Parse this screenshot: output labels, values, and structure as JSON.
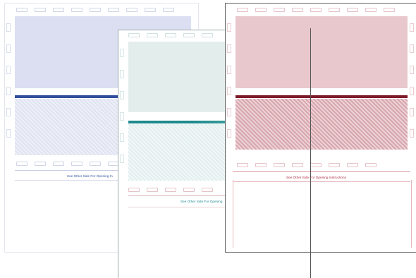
{
  "colors": {
    "blue": {
      "panel": "#dcdff2",
      "band": "#2f4f9c",
      "pattern": "#cfd6ea",
      "ink": "#2f4f9c",
      "holes": "#aab3d6"
    },
    "green": {
      "panel": "#e3eeec",
      "band": "#1d8a8c",
      "pattern": "#dde9ea",
      "ink": "#1d8a8c",
      "holes": "#a7c9c8"
    },
    "red": {
      "panel": "#e8c8cc",
      "band": "#7e1a2a",
      "pattern": "#cf98a2",
      "ink": "#b0283c",
      "holes": "#d0909a"
    }
  },
  "forms": [
    {
      "id": "blue",
      "caption": "See Other Side For Opening In"
    },
    {
      "id": "green",
      "caption": "See Other Side For Opening"
    },
    {
      "id": "red",
      "caption": "See Other Side For Opening Instructions"
    }
  ]
}
